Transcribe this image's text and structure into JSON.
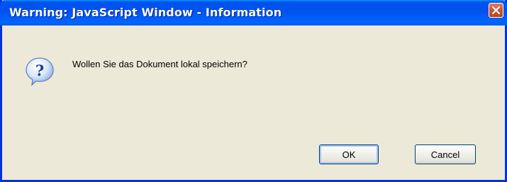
{
  "window": {
    "title": "Warning: JavaScript Window - Information"
  },
  "titlebar": {
    "close_icon": "close-icon"
  },
  "dialog": {
    "icon": "question-icon",
    "message": "Wollen Sie das Dokument lokal speichern?"
  },
  "buttons": {
    "ok_label": "OK",
    "cancel_label": "Cancel"
  },
  "colors": {
    "titlebar": "#0054e3",
    "close_button": "#d3542f",
    "window_border": "#0831d9",
    "dialog_background": "#ece9d8",
    "focus_ring": "#a8c8f5"
  }
}
